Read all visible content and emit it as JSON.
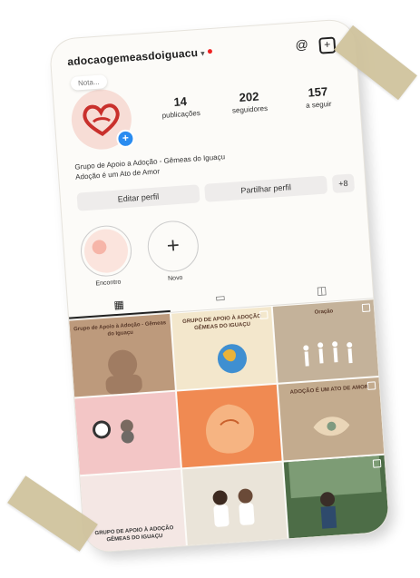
{
  "profile": {
    "username": "adocaogemeasdoiguacu",
    "note": "Nota...",
    "stats": [
      {
        "value": "14",
        "label": "publicações"
      },
      {
        "value": "202",
        "label": "seguidores"
      },
      {
        "value": "157",
        "label": "a seguir"
      }
    ],
    "bio_line1": "Grupo de Apoio a Adoção - Gêmeas do Iguaçu",
    "bio_line2": "Adoção é um Ato de Amor"
  },
  "buttons": {
    "edit": "Editar perfil",
    "share": "Partilhar perfil",
    "add_user": "+8"
  },
  "highlights": [
    {
      "label": "Encontro"
    },
    {
      "label": "Novo"
    }
  ],
  "tabs": [
    {
      "icon": "grid-icon"
    },
    {
      "icon": "reels-icon"
    },
    {
      "icon": "tagged-icon"
    }
  ],
  "posts": {
    "p1_text": "Grupo de Apoio à Adoção - Gêmeas do Iguaçu",
    "p2_text": "GRUPO DE APOIO À ADOÇÃO GÊMEAS DO IGUAÇU",
    "p3_text": "Oração",
    "p6_text": "ADOÇÃO É UM ATO DE AMOR",
    "p7_text": "GRUPO DE APOIO À ADOÇÃO GÊMEAS DO IGUAÇU"
  },
  "colors": {
    "accent_blue": "#2a8cf0",
    "tape": "#cfc29b",
    "notification_red": "#e22222"
  }
}
